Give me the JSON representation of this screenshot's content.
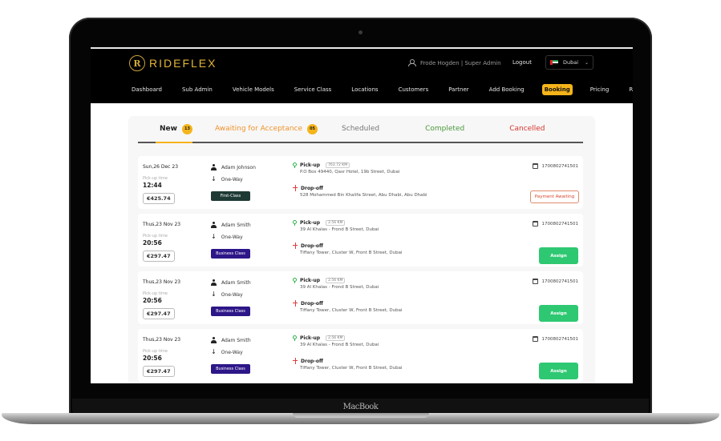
{
  "device": {
    "label": "MacBook"
  },
  "app": {
    "brand": {
      "mark": "R",
      "name": "RIDEFLEX",
      "accent": "#f5b41a"
    },
    "user": {
      "label": "Frode Hogden  | Super Admin"
    },
    "logout_label": "Logout",
    "city": {
      "selected": "Dubai",
      "flag": "uae-flag"
    },
    "nav": [
      {
        "label": "Dashboard",
        "active": false
      },
      {
        "label": "Sub Admin",
        "active": false
      },
      {
        "label": "Vehicle Models",
        "active": false
      },
      {
        "label": "Service Class",
        "active": false
      },
      {
        "label": "Locations",
        "active": false
      },
      {
        "label": "Customers",
        "active": false
      },
      {
        "label": "Partner",
        "active": false
      },
      {
        "label": "Add Booking",
        "active": false
      },
      {
        "label": "Booking",
        "active": true
      },
      {
        "label": "Pricing",
        "active": false
      },
      {
        "label": "Reports",
        "active": false
      }
    ]
  },
  "tabs": [
    {
      "label": "New",
      "count": "13",
      "active": true,
      "color": "#222222"
    },
    {
      "label": "Awaiting for Acceptance",
      "count": "05",
      "active": false,
      "color": "#f0932b"
    },
    {
      "label": "Scheduled",
      "active": false,
      "color": "#777777"
    },
    {
      "label": "Completed",
      "active": false,
      "color": "#4a9a3a"
    },
    {
      "label": "Cancelled",
      "active": false,
      "color": "#d8352e"
    }
  ],
  "labels": {
    "pickup_time": "Pick-up time",
    "pickup": "Pick-up",
    "dropoff": "Drop-off"
  },
  "bookings": [
    {
      "date": "Sun,26 Dec 23",
      "time": "12:44",
      "price": "€425.74",
      "customer": "Adam Johnson",
      "trip_type": "One-Way",
      "service_class": "First-Class",
      "pickup_km": "763.72 KM",
      "pickup_address": "P.O Box 49440, Qasr Hotel, 19b Street, Dubai",
      "dropoff_address": "528 Mohammed Bin Khalifa Street, Abu Dhabi, Abu Dhabi",
      "reference": "1700802741501",
      "action": "Payment Awaiting"
    },
    {
      "date": "Thus,23 Nov 23",
      "time": "20:56",
      "price": "€297.47",
      "customer": "Adam Smith",
      "trip_type": "One-Way",
      "service_class": "Business Class",
      "pickup_km": "2.56 KM",
      "pickup_address": "39 Al Khalas - Frond B Street, Dubai",
      "dropoff_address": "Tiffany Tower, Cluster W, Front B Street, Dubai",
      "reference": "1700802741501",
      "action": "Assign"
    },
    {
      "date": "Thus,23 Nov 23",
      "time": "20:56",
      "price": "€297.47",
      "customer": "Adam Smith",
      "trip_type": "One-Way",
      "service_class": "Business Class",
      "pickup_km": "2.56 KM",
      "pickup_address": "39 Al Khalas - Frond B Street, Dubai",
      "dropoff_address": "Tiffany Tower, Cluster W, Front B Street, Dubai",
      "reference": "1700802741501",
      "action": "Assign"
    },
    {
      "date": "Thus,23 Nov 23",
      "time": "20:56",
      "price": "€297.47",
      "customer": "Adam Smith",
      "trip_type": "One-Way",
      "service_class": "Business Class",
      "pickup_km": "2.56 KM",
      "pickup_address": "39 Al Khalas - Frond B Street, Dubai",
      "dropoff_address": "Tiffany Tower, Cluster W, Front B Street, Dubai",
      "reference": "1700802741501",
      "action": "Assign"
    }
  ]
}
